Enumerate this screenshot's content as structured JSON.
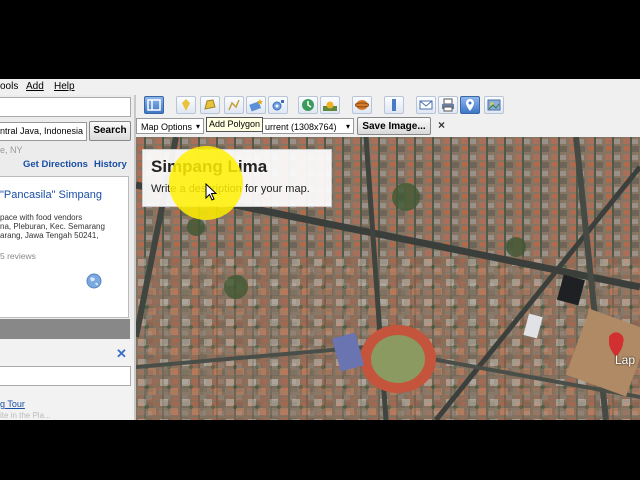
{
  "menu": {
    "tools": "ools",
    "add": "Add",
    "help": "Help"
  },
  "search": {
    "query_value": "ntral Java, Indonesia",
    "search_label": "Search",
    "hint": "e, NY",
    "get_directions": "Get Directions",
    "history": "History"
  },
  "result": {
    "name": "\"Pancasila\" Simpang",
    "address_lines": [
      "pace with food vendors",
      "na, Pleburan, Kec. Semarang",
      "arang, Jawa Tengah 50241,"
    ],
    "reviews": "5 reviews"
  },
  "panel2": {
    "tour_link": "g Tour",
    "tour_faded": "ite in the Pla..."
  },
  "toolbar": {
    "icons": [
      "sidebar-icon",
      "placemark-icon",
      "add-polygon-icon",
      "add-path-icon",
      "image-overlay-icon",
      "record-tour-icon",
      "historical-imagery-icon",
      "sunlight-icon",
      "planet-icon",
      "ruler-icon",
      "email-icon",
      "print-icon",
      "view-in-maps-icon",
      "save-image-icon"
    ],
    "tooltip": "Add Polygon"
  },
  "options_bar": {
    "map_options": "Map Options",
    "size": "urrent (1308x764)",
    "save_image": "Save Image...",
    "close": "×"
  },
  "map": {
    "title": "Simpang Lima",
    "description": "Write a description for your map.",
    "place_label": "Lap"
  },
  "colors": {
    "link": "#1a4fa3",
    "highlight": "#ffef00",
    "active_tool": "#3d77c8"
  }
}
